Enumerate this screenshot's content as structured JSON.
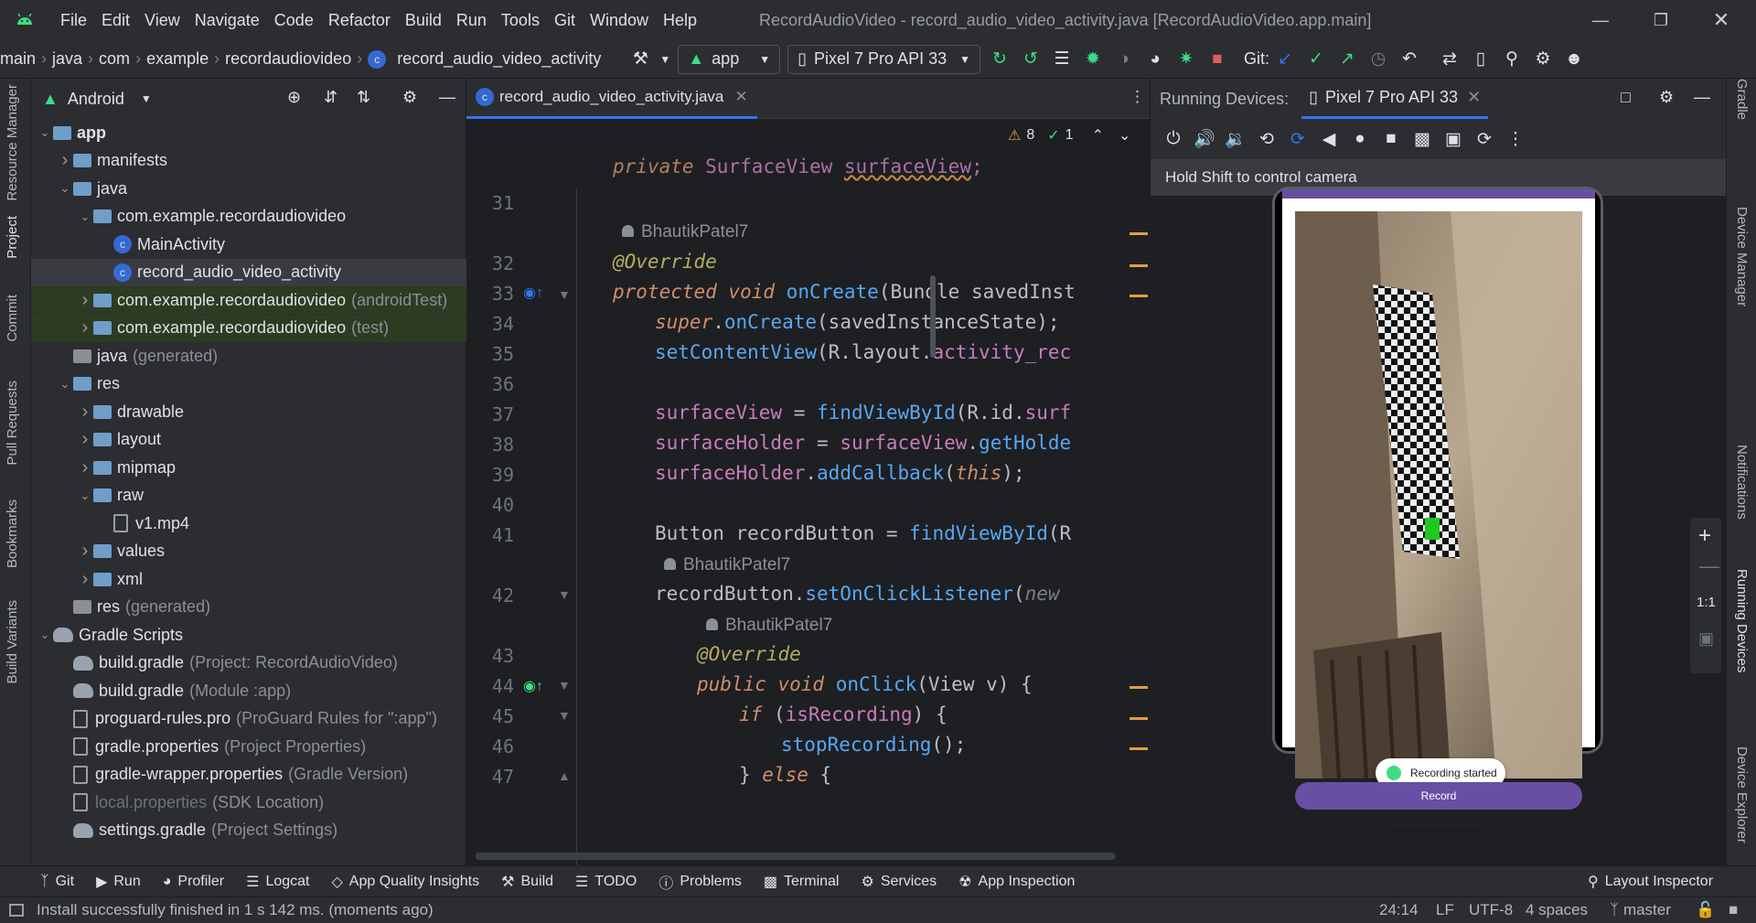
{
  "window": {
    "menu": [
      "File",
      "Edit",
      "View",
      "Navigate",
      "Code",
      "Refactor",
      "Build",
      "Run",
      "Tools",
      "Git",
      "Window",
      "Help"
    ],
    "title": "RecordAudioVideo - record_audio_video_activity.java [RecordAudioVideo.app.main]"
  },
  "toolbar": {
    "breadcrumb": [
      "main",
      "java",
      "com",
      "example",
      "recordaudiovideo",
      "record_audio_video_activity"
    ],
    "run_config": "app",
    "device": "Pixel 7 Pro API 33",
    "git_label": "Git:"
  },
  "left_strip": [
    "Resource Manager",
    "Project",
    "Commit",
    "Pull Requests",
    "Bookmarks",
    "Build Variants"
  ],
  "project": {
    "view_mode": "Android",
    "tree": [
      {
        "label": "app",
        "suffix": "",
        "depth": 0,
        "expanded": true,
        "icon": "module"
      },
      {
        "label": "manifests",
        "suffix": "",
        "depth": 1,
        "expanded": false,
        "icon": "folder"
      },
      {
        "label": "java",
        "suffix": "",
        "depth": 1,
        "expanded": true,
        "icon": "folder"
      },
      {
        "label": "com.example.recordaudiovideo",
        "suffix": "",
        "depth": 2,
        "expanded": true,
        "icon": "folder"
      },
      {
        "label": "MainActivity",
        "suffix": "",
        "depth": 3,
        "icon": "class"
      },
      {
        "label": "record_audio_video_activity",
        "suffix": "",
        "depth": 3,
        "icon": "class",
        "selected": true
      },
      {
        "label": "com.example.recordaudiovideo",
        "suffix": "(androidTest)",
        "depth": 2,
        "expanded": false,
        "icon": "folder",
        "highlight": true
      },
      {
        "label": "com.example.recordaudiovideo",
        "suffix": "(test)",
        "depth": 2,
        "expanded": false,
        "icon": "folder",
        "highlight": true
      },
      {
        "label": "java",
        "suffix": "(generated)",
        "depth": 1,
        "icon": "folder-gen"
      },
      {
        "label": "res",
        "suffix": "",
        "depth": 1,
        "expanded": true,
        "icon": "folder"
      },
      {
        "label": "drawable",
        "suffix": "",
        "depth": 2,
        "expanded": false,
        "icon": "folder"
      },
      {
        "label": "layout",
        "suffix": "",
        "depth": 2,
        "expanded": false,
        "icon": "folder"
      },
      {
        "label": "mipmap",
        "suffix": "",
        "depth": 2,
        "expanded": false,
        "icon": "folder"
      },
      {
        "label": "raw",
        "suffix": "",
        "depth": 2,
        "expanded": true,
        "icon": "folder"
      },
      {
        "label": "v1.mp4",
        "suffix": "",
        "depth": 3,
        "icon": "file"
      },
      {
        "label": "values",
        "suffix": "",
        "depth": 2,
        "expanded": false,
        "icon": "folder"
      },
      {
        "label": "xml",
        "suffix": "",
        "depth": 2,
        "expanded": false,
        "icon": "folder"
      },
      {
        "label": "res",
        "suffix": "(generated)",
        "depth": 1,
        "icon": "folder-gen"
      },
      {
        "label": "Gradle Scripts",
        "suffix": "",
        "depth": 0,
        "expanded": true,
        "icon": "gradle"
      },
      {
        "label": "build.gradle",
        "suffix": "(Project: RecordAudioVideo)",
        "depth": 1,
        "icon": "gradle"
      },
      {
        "label": "build.gradle",
        "suffix": "(Module :app)",
        "depth": 1,
        "icon": "gradle"
      },
      {
        "label": "proguard-rules.pro",
        "suffix": "(ProGuard Rules for \":app\")",
        "depth": 1,
        "icon": "file"
      },
      {
        "label": "gradle.properties",
        "suffix": "(Project Properties)",
        "depth": 1,
        "icon": "file"
      },
      {
        "label": "gradle-wrapper.properties",
        "suffix": "(Gradle Version)",
        "depth": 1,
        "icon": "file"
      },
      {
        "label": "local.properties",
        "suffix": "(SDK Location)",
        "depth": 1,
        "icon": "file",
        "dim": true
      },
      {
        "label": "settings.gradle",
        "suffix": "(Project Settings)",
        "depth": 1,
        "icon": "gradle"
      }
    ]
  },
  "editor": {
    "tab": "record_audio_video_activity.java",
    "warnings": "8",
    "checks": "1",
    "author": "BhautikPatel7",
    "lines": [
      "31",
      "32",
      "33",
      "34",
      "35",
      "36",
      "37",
      "38",
      "39",
      "40",
      "41",
      "42",
      "43",
      "44",
      "45",
      "46",
      "47"
    ]
  },
  "running_devices": {
    "label": "Running Devices:",
    "device_tab": "Pixel 7 Pro API 33",
    "hint": "Hold Shift to control camera",
    "zoom_label": "1:1"
  },
  "phone": {
    "toast": "Recording started",
    "button": "Record"
  },
  "right_strip": [
    "Gradle",
    "Device Manager",
    "Notifications",
    "Running Devices",
    "Device Explorer"
  ],
  "bottom_tools": [
    "Git",
    "Run",
    "Profiler",
    "Logcat",
    "App Quality Insights",
    "Build",
    "TODO",
    "Problems",
    "Terminal",
    "Services",
    "App Inspection"
  ],
  "layout_inspector": "Layout Inspector",
  "status": {
    "message": "Install successfully finished in 1 s 142 ms. (moments ago)",
    "position": "24:14",
    "line_sep": "LF",
    "encoding": "UTF-8",
    "indent": "4 spaces",
    "branch": "master"
  },
  "colors": {
    "accent": "#3574f0",
    "android": "#3ddc84",
    "record_button": "#6750a4",
    "highlight_row": "#2d3b22"
  }
}
